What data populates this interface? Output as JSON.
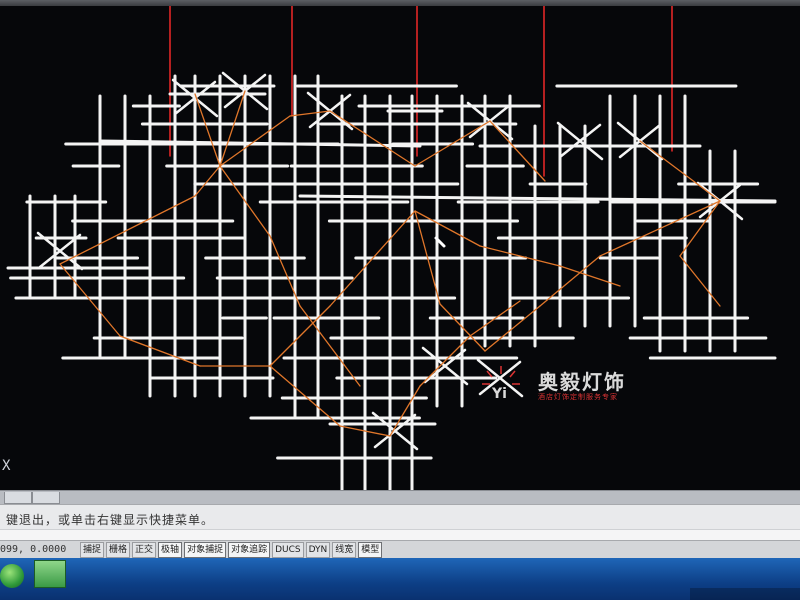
{
  "app": {
    "accent_line": "#ff2a2a",
    "grid_color": "#f4f4f4",
    "route_color": "#e0762a",
    "background": "#06070a"
  },
  "watermark": {
    "logo_text": "Yi",
    "name": "奥毅灯饰",
    "slogan": "酒店灯饰定制服务专家"
  },
  "ucs": {
    "icon": "ucs-x-icon",
    "glyph": "X"
  },
  "command_line": {
    "prompt_text": "键退出，或单击右键显示快捷菜单。",
    "input_value": ""
  },
  "status_bar": {
    "coordinates": "099, 0.0000",
    "buttons": [
      {
        "label": "捕捉",
        "active": false
      },
      {
        "label": "栅格",
        "active": false
      },
      {
        "label": "正交",
        "active": false
      },
      {
        "label": "极轴",
        "active": true
      },
      {
        "label": "对象捕捉",
        "active": true
      },
      {
        "label": "对象追踪",
        "active": true
      },
      {
        "label": "DUCS",
        "active": false
      },
      {
        "label": "DYN",
        "active": false
      },
      {
        "label": "线宽",
        "active": false
      },
      {
        "label": "模型",
        "active": true
      }
    ]
  },
  "taskbar": {
    "start_icon": "windows-start-icon",
    "app_icon": "autocad-app-icon"
  }
}
